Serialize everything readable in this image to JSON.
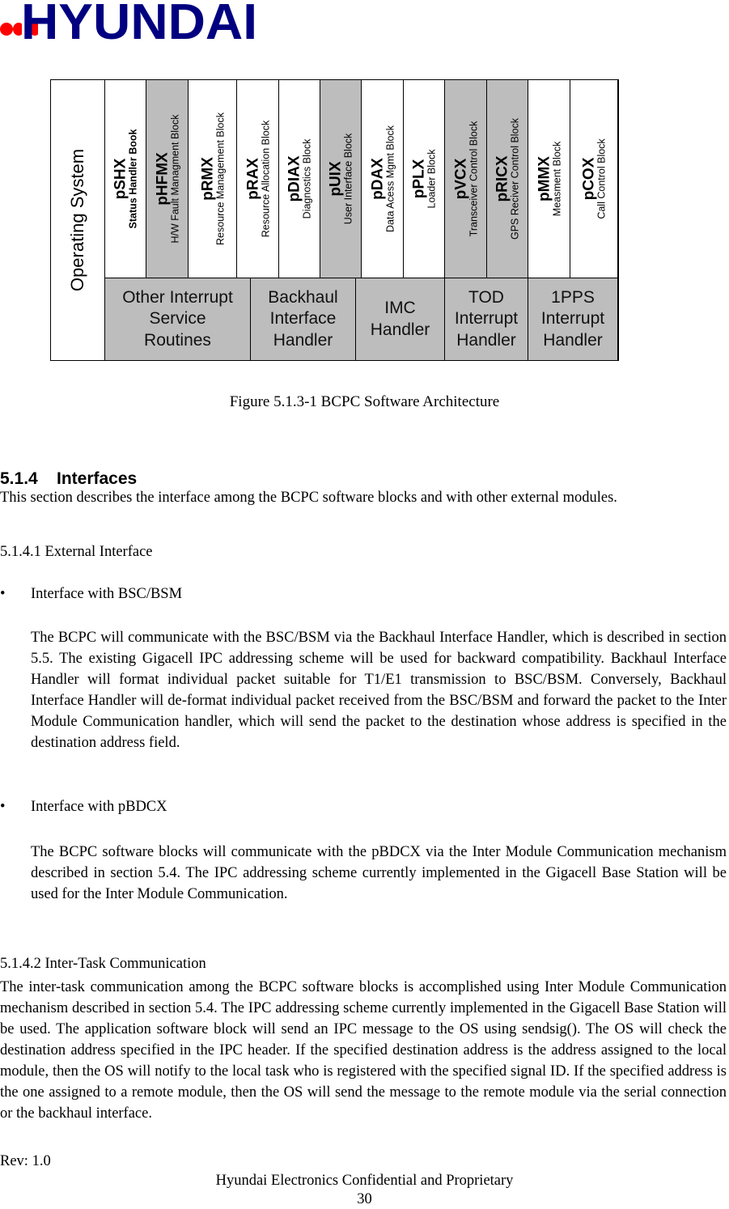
{
  "header": {
    "logo_text": "HYUNDAI",
    "logo_colors": {
      "text": "#000080",
      "dots": "#ff0000"
    }
  },
  "figure": {
    "os_label": "Operating System",
    "blocks": [
      {
        "name": "pSHX",
        "desc": "Status Handler Book",
        "shaded": false
      },
      {
        "name": "pHFMX",
        "desc": "H/W  Fault Managment Block",
        "shaded": true
      },
      {
        "name": "pRMX",
        "desc": "Resource Management Block",
        "shaded": false
      },
      {
        "name": "pRAX",
        "desc": "Resource Allocation Block",
        "shaded": false
      },
      {
        "name": "pDIAX",
        "desc": "Diagnostics Block",
        "shaded": false
      },
      {
        "name": "pUIX",
        "desc": "User Interface Block",
        "shaded": true
      },
      {
        "name": "pDAX",
        "desc": "Data Acess Mgmt Block",
        "shaded": false
      },
      {
        "name": "pPLX",
        "desc": "Loader Block",
        "shaded": false
      },
      {
        "name": "pVCX",
        "desc": "Transceiver Control Block",
        "shaded": true
      },
      {
        "name": "pRICX",
        "desc": "GPS Reciver Control Block",
        "shaded": true
      },
      {
        "name": "pMMX",
        "desc": "Measment Block",
        "shaded": false
      },
      {
        "name": "pCOX",
        "desc": "Call Control Block",
        "shaded": false
      }
    ],
    "handlers": [
      {
        "lines": [
          "Other Interrupt",
          "Service",
          "Routines"
        ]
      },
      {
        "lines": [
          "Backhaul",
          "Interface",
          "Handler"
        ]
      },
      {
        "lines": [
          "IMC",
          "Handler"
        ]
      },
      {
        "lines": [
          "TOD",
          "Interrupt",
          "Handler"
        ]
      },
      {
        "lines": [
          "1PPS",
          "Interrupt",
          "Handler"
        ]
      }
    ],
    "shade_color": "#bdbdbd",
    "caption": "Figure 5.1.3-1 BCPC Software Architecture"
  },
  "section": {
    "number": "5.1.4",
    "title": "Interfaces",
    "intro": "This section describes the interface among the BCPC software blocks and with other external modules.",
    "sub1": {
      "heading": "5.1.4.1  External Interface",
      "bullets": [
        {
          "marker": "•",
          "title": "Interface with BSC/BSM",
          "body": "The BCPC will communicate with the BSC/BSM via the Backhaul Interface Handler, which is described in section 5.5.  The existing Gigacell IPC addressing scheme will be used for backward compatibility. Backhaul Interface Handler will format individual packet suitable for T1/E1 transmission to BSC/BSM.  Conversely, Backhaul Interface Handler will de-format individual packet received from the BSC/BSM and forward the packet to the Inter Module Communication handler, which will send the packet to the destination whose address is specified in the destination address field."
        },
        {
          "marker": "•",
          "title": "Interface with pBDCX",
          "body": "The BCPC software blocks will communicate with the pBDCX via the Inter Module Communication mechanism described in section 5.4. The IPC addressing scheme currently implemented in the Gigacell Base Station will be used for the Inter Module Communication."
        }
      ]
    },
    "sub2": {
      "heading": "5.1.4.2  Inter-Task Communication",
      "body": "The inter-task communication among the BCPC software blocks is accomplished using Inter Module Communication mechanism described in section 5.4.  The IPC addressing scheme currently implemented in the Gigacell Base Station will be used.  The application software block will send an IPC message to the OS using sendsig(). The OS will check the destination address specified in the IPC header. If the specified destination address is the address assigned to the local module, then the OS will notify to the local task who is registered with the specified signal ID. If the specified address is the one assigned to a remote module, then the OS will send the message to the remote module via the serial connection or the backhaul interface."
    }
  },
  "footer": {
    "rev": "Rev: 1.0",
    "confidential": "Hyundai Electronics Confidential and Proprietary",
    "page_number": "30"
  }
}
